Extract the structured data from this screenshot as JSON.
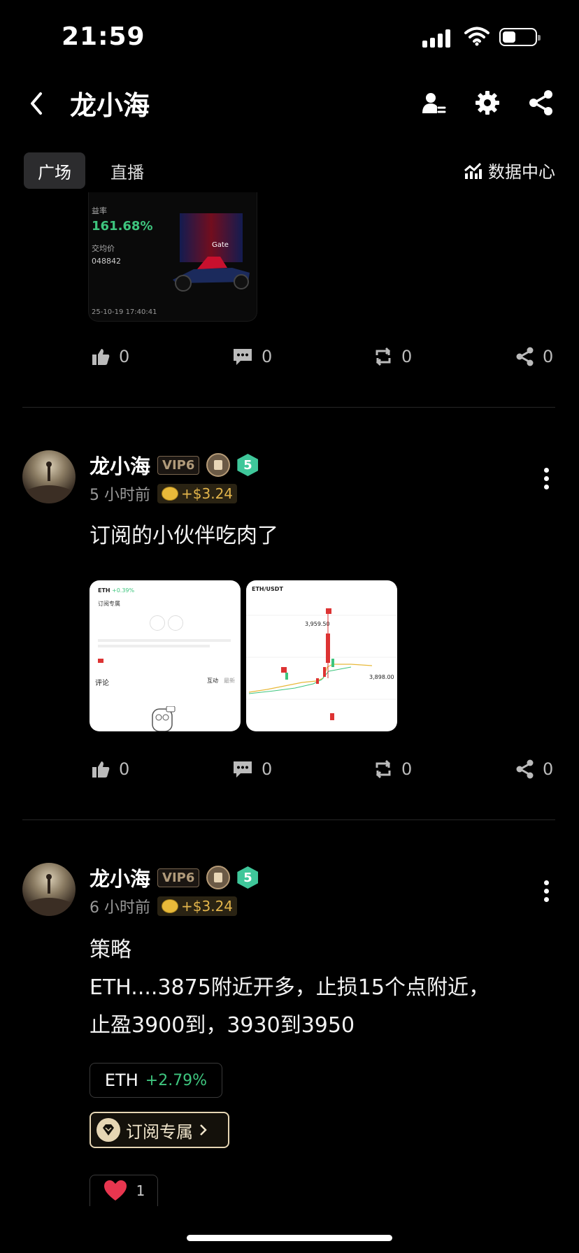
{
  "status": {
    "time": "21:59"
  },
  "nav": {
    "title": "龙小海",
    "icons": [
      "back-icon",
      "user-follow-icon",
      "gear-icon",
      "share-icon"
    ]
  },
  "tabs": [
    {
      "label": "广场",
      "active": true
    },
    {
      "label": "直播",
      "active": false
    }
  ],
  "data_center": {
    "label": "数据中心"
  },
  "snippet": {
    "line1": "益率",
    "line2": "161.68%",
    "line3": "交均价",
    "line4": "048842",
    "line5": "25-10-19 17:40:41",
    "logo": "Gate"
  },
  "post0_actions": {
    "like": "0",
    "comment": "0",
    "repost": "0",
    "share": "0"
  },
  "posts": [
    {
      "username": "龙小海",
      "vip": "VIP6",
      "level": "5",
      "time": "5 小时前",
      "earn": "+$3.24",
      "text": "订阅的小伙伴吃肉了",
      "images": [
        {
          "header": "ETH",
          "pct": "+0.39%",
          "tag": "订阅专属",
          "comment_label": "评论",
          "tab1": "互动",
          "tab2": "最新"
        },
        {
          "header": "ETH/USDT",
          "price_hi": "3,959.50",
          "price_now": "3,898.00"
        }
      ],
      "actions": {
        "like": "0",
        "comment": "0",
        "repost": "0",
        "share": "0"
      }
    },
    {
      "username": "龙小海",
      "vip": "VIP6",
      "level": "5",
      "time": "6 小时前",
      "earn": "+$3.24",
      "text_lines": [
        "策略",
        "ETH....3875附近开多，止损15个点附近，",
        "止盈3900到，3930到3950"
      ],
      "chip": {
        "symbol": "ETH",
        "pct": "+2.79%"
      },
      "subscribe": {
        "label": "订阅专属"
      },
      "likes": "1"
    }
  ],
  "colors": {
    "background": "#000000",
    "green": "#3ec57e",
    "gold": "#e3b54b",
    "vip": "#b09a7a",
    "level": "#3fc79a"
  }
}
